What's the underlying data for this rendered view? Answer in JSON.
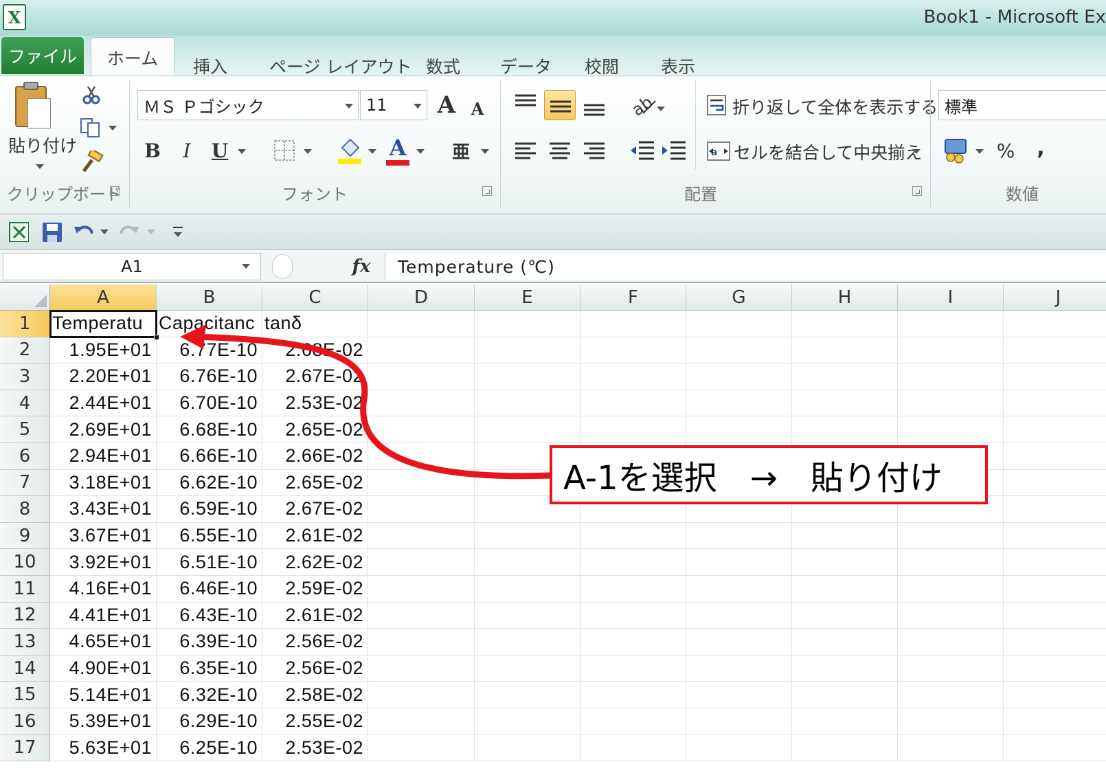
{
  "window": {
    "title": "Book1  -  Microsoft Ex",
    "app_icon_letter": "X"
  },
  "tabs": [
    {
      "id": "file",
      "label": "ファイル"
    },
    {
      "id": "home",
      "label": "ホーム"
    },
    {
      "id": "insert",
      "label": "挿入"
    },
    {
      "id": "page-layout",
      "label": "ページ レイアウト"
    },
    {
      "id": "formulas",
      "label": "数式"
    },
    {
      "id": "data",
      "label": "データ"
    },
    {
      "id": "review",
      "label": "校閲"
    },
    {
      "id": "view",
      "label": "表示"
    }
  ],
  "ribbon": {
    "clipboard": {
      "paste_label": "貼り付け",
      "group_label": "クリップボード"
    },
    "font": {
      "font_name": "ＭＳ Ｐゴシック",
      "font_size": "11",
      "grow_label": "A",
      "shrink_label": "A",
      "bold": "B",
      "italic": "I",
      "underline": "U",
      "font_color_glyph": "A",
      "phonetic_glyph": "亜",
      "group_label": "フォント",
      "highlight_color": "#ffeb00",
      "font_color": "#e01b1b"
    },
    "alignment": {
      "wrap_text": "折り返して全体を表示する",
      "merge_center": "セルを結合して中央揃え",
      "group_label": "配置"
    },
    "number": {
      "format": "標準",
      "percent": "%",
      "comma": ",",
      "group_label": "数値"
    }
  },
  "formula_bar": {
    "name_box": "A1",
    "fx_label": "fx",
    "content": "Temperature (℃)"
  },
  "sheet": {
    "columns": [
      "A",
      "B",
      "C",
      "D",
      "E",
      "F",
      "G",
      "H",
      "I",
      "J"
    ],
    "selected_column": "A",
    "selected_row": "1",
    "header_row": [
      "Temperatu",
      "Capacitanc",
      "tanδ"
    ],
    "rows": [
      {
        "n": "2",
        "a": "1.95E+01",
        "b": "6.77E-10",
        "c": "2.68E-02"
      },
      {
        "n": "3",
        "a": "2.20E+01",
        "b": "6.76E-10",
        "c": "2.67E-02"
      },
      {
        "n": "4",
        "a": "2.44E+01",
        "b": "6.70E-10",
        "c": "2.53E-02"
      },
      {
        "n": "5",
        "a": "2.69E+01",
        "b": "6.68E-10",
        "c": "2.65E-02"
      },
      {
        "n": "6",
        "a": "2.94E+01",
        "b": "6.66E-10",
        "c": "2.66E-02"
      },
      {
        "n": "7",
        "a": "3.18E+01",
        "b": "6.62E-10",
        "c": "2.65E-02"
      },
      {
        "n": "8",
        "a": "3.43E+01",
        "b": "6.59E-10",
        "c": "2.67E-02"
      },
      {
        "n": "9",
        "a": "3.67E+01",
        "b": "6.55E-10",
        "c": "2.61E-02"
      },
      {
        "n": "10",
        "a": "3.92E+01",
        "b": "6.51E-10",
        "c": "2.62E-02"
      },
      {
        "n": "11",
        "a": "4.16E+01",
        "b": "6.46E-10",
        "c": "2.59E-02"
      },
      {
        "n": "12",
        "a": "4.41E+01",
        "b": "6.43E-10",
        "c": "2.61E-02"
      },
      {
        "n": "13",
        "a": "4.65E+01",
        "b": "6.39E-10",
        "c": "2.56E-02"
      },
      {
        "n": "14",
        "a": "4.90E+01",
        "b": "6.35E-10",
        "c": "2.56E-02"
      },
      {
        "n": "15",
        "a": "5.14E+01",
        "b": "6.32E-10",
        "c": "2.58E-02"
      },
      {
        "n": "16",
        "a": "5.39E+01",
        "b": "6.29E-10",
        "c": "2.55E-02"
      },
      {
        "n": "17",
        "a": "5.63E+01",
        "b": "6.25E-10",
        "c": "2.53E-02"
      }
    ]
  },
  "annotation": {
    "text": "A-1を選択　→　貼り付け",
    "color": "#e8141b"
  },
  "colors": {
    "file_tab": "#1f7d34",
    "selection_header": "#f6c95c"
  }
}
